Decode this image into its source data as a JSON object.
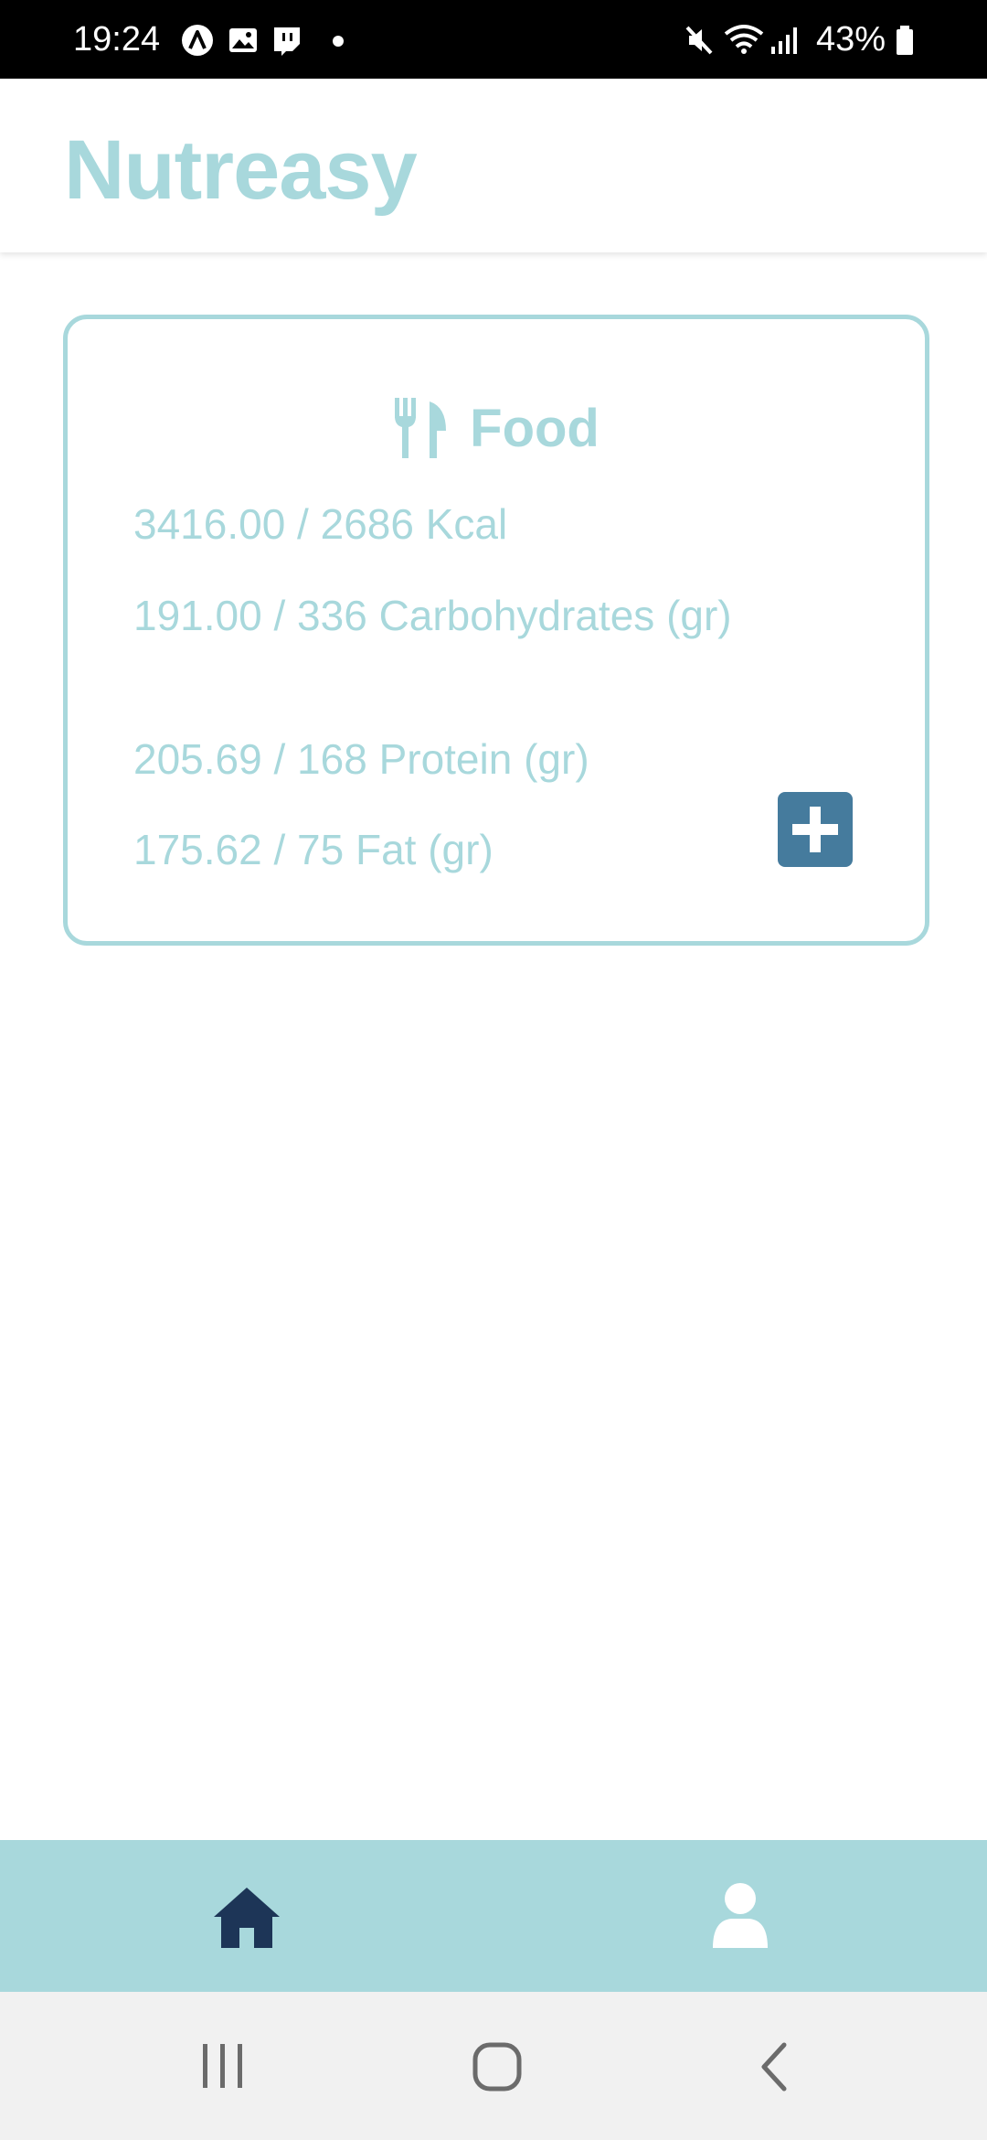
{
  "status_bar": {
    "time": "19:24",
    "battery_percent": "43%",
    "left_icons": [
      "app-a-icon",
      "gallery-icon",
      "twitch-icon",
      "dot-icon"
    ],
    "right_icons": [
      "mute-icon",
      "wifi-icon",
      "signal-icon",
      "battery-icon"
    ]
  },
  "app_bar": {
    "title": "Nutreasy"
  },
  "food_card": {
    "icon": "utensils-icon",
    "title": "Food",
    "stats": {
      "kcal": "3416.00 / 2686 Kcal",
      "carbohydrates": "191.00 / 336 Carbohydrates (gr)",
      "protein": "205.69 / 168 Protein (gr)",
      "fat": "175.62 / 75 Fat (gr)"
    },
    "add_button_icon": "plus-icon"
  },
  "bottom_nav": {
    "items": [
      {
        "icon": "home-icon",
        "active": true
      },
      {
        "icon": "user-icon",
        "active": false
      }
    ]
  },
  "system_nav": {
    "items": [
      "recent-apps-icon",
      "home-circle-icon",
      "back-icon"
    ]
  },
  "colors": {
    "accent": "#a8d8dc",
    "button": "#457b9d",
    "active_nav_icon": "#1d3557",
    "inactive_nav_icon": "#ffffff",
    "status_bar": "#000000",
    "system_nav": "#f1f1f1"
  }
}
